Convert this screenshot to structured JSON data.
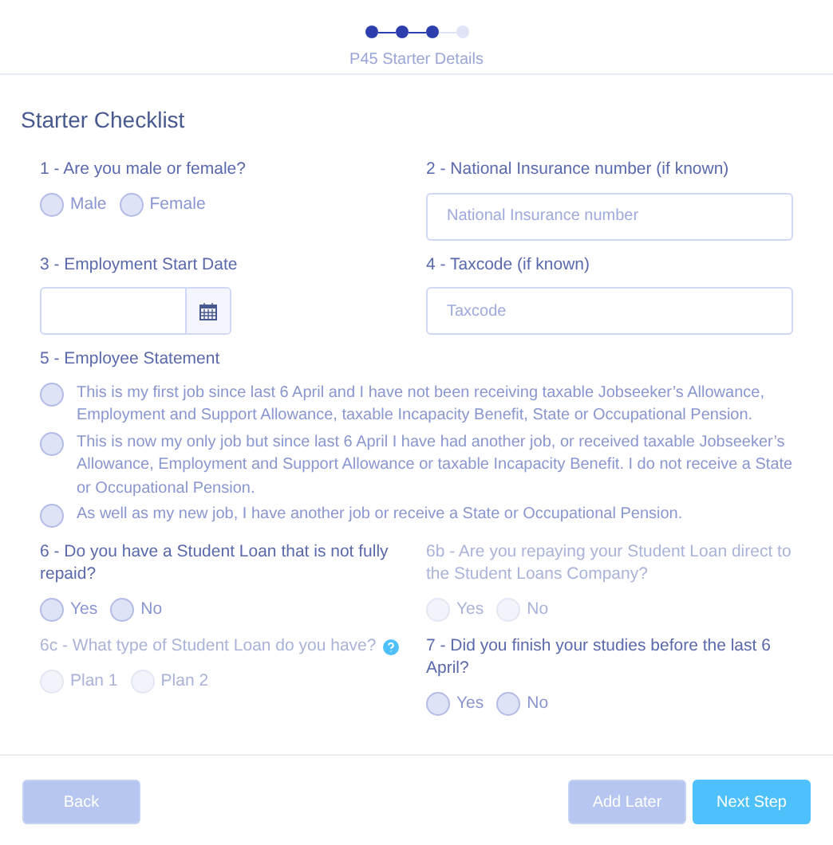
{
  "stepper": {
    "steps": [
      {
        "done": true
      },
      {
        "done": true
      },
      {
        "done": true
      },
      {
        "done": false
      }
    ],
    "label": "P45 Starter Details"
  },
  "title": "Starter Checklist",
  "questions": [
    {
      "kind": "radio",
      "label": "1 - Are you male or female?",
      "disabled": false,
      "options": [
        {
          "label": "Male",
          "checked": false
        },
        {
          "label": "Female",
          "checked": false
        }
      ]
    },
    {
      "kind": "text",
      "label": "2 - National Insurance number (if known)",
      "disabled": false,
      "placeholder": "National Insurance number"
    },
    {
      "kind": "date",
      "label": "3 - Employment Start Date",
      "disabled": false
    },
    {
      "kind": "text",
      "label": "4 - Taxcode (if known)",
      "disabled": false,
      "placeholder": "Taxcode"
    },
    {
      "kind": "statement",
      "label": "5 - Employee Statement",
      "disabled": false,
      "options": [
        {
          "label": "This is my first job since last 6 April and I have not been receiving taxable Jobseeker’s Allowance, Employment and Support Allowance, taxable Incapacity Benefit, State or Occupational Pension.",
          "checked": false
        },
        {
          "label": "This is now my only job but since last 6 April I have had another job, or received taxable Jobseeker’s Allowance, Employment and Support Allowance or taxable Incapacity Benefit. I do not receive a State or Occupational Pension.",
          "checked": false
        },
        {
          "label": "As well as my new job, I have another job or receive a State or Occupational Pension.",
          "checked": false
        }
      ]
    },
    {
      "kind": "radio",
      "label": "6 - Do you have a Student Loan that is not fully repaid?",
      "disabled": false,
      "options": [
        {
          "label": "Yes",
          "checked": false
        },
        {
          "label": "No",
          "checked": false
        }
      ]
    },
    {
      "kind": "radio",
      "label": "6b - Are you repaying your Student Loan direct to the Student Loans Company?",
      "disabled": true,
      "options": [
        {
          "label": "Yes",
          "checked": false
        },
        {
          "label": "No",
          "checked": false
        }
      ]
    },
    {
      "kind": "radio",
      "label": "6c - What type of Student Loan do you have?",
      "help": true,
      "disabled": true,
      "options": [
        {
          "label": "Plan 1",
          "checked": false
        },
        {
          "label": "Plan 2",
          "checked": false
        }
      ]
    },
    {
      "kind": "radio",
      "label": "7 - Did you finish your studies before the last 6 April?",
      "disabled": false,
      "options": [
        {
          "label": "Yes",
          "checked": false
        },
        {
          "label": "No",
          "checked": false
        }
      ]
    }
  ],
  "buttons": [
    {
      "label": "Back",
      "kind": "secondary"
    },
    {
      "label": "Add Later",
      "kind": "secondary"
    },
    {
      "label": "Next Step",
      "kind": "primary"
    }
  ]
}
